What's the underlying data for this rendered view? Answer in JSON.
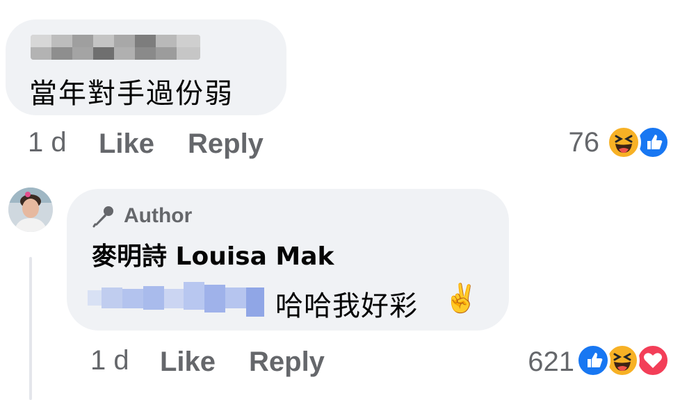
{
  "comment": {
    "text": "當年對手過份弱",
    "time": "1 d",
    "like_label": "Like",
    "reply_label": "Reply",
    "reaction_count": "76",
    "reactions": [
      "haha-icon",
      "like-icon"
    ]
  },
  "reply": {
    "badge": "Author",
    "author": "麥明詩 Louisa Mak",
    "text": "哈哈我好彩",
    "emoji": "✌️",
    "time": "1 d",
    "like_label": "Like",
    "reply_label": "Reply",
    "reaction_count": "621",
    "reactions": [
      "like-icon",
      "haha-icon",
      "love-icon"
    ]
  },
  "colors": {
    "bubble": "#f0f2f5",
    "meta_text": "#65676b",
    "like_blue": "#1877f2",
    "haha_yellow": "#f7b125",
    "love_red": "#f33e58"
  }
}
